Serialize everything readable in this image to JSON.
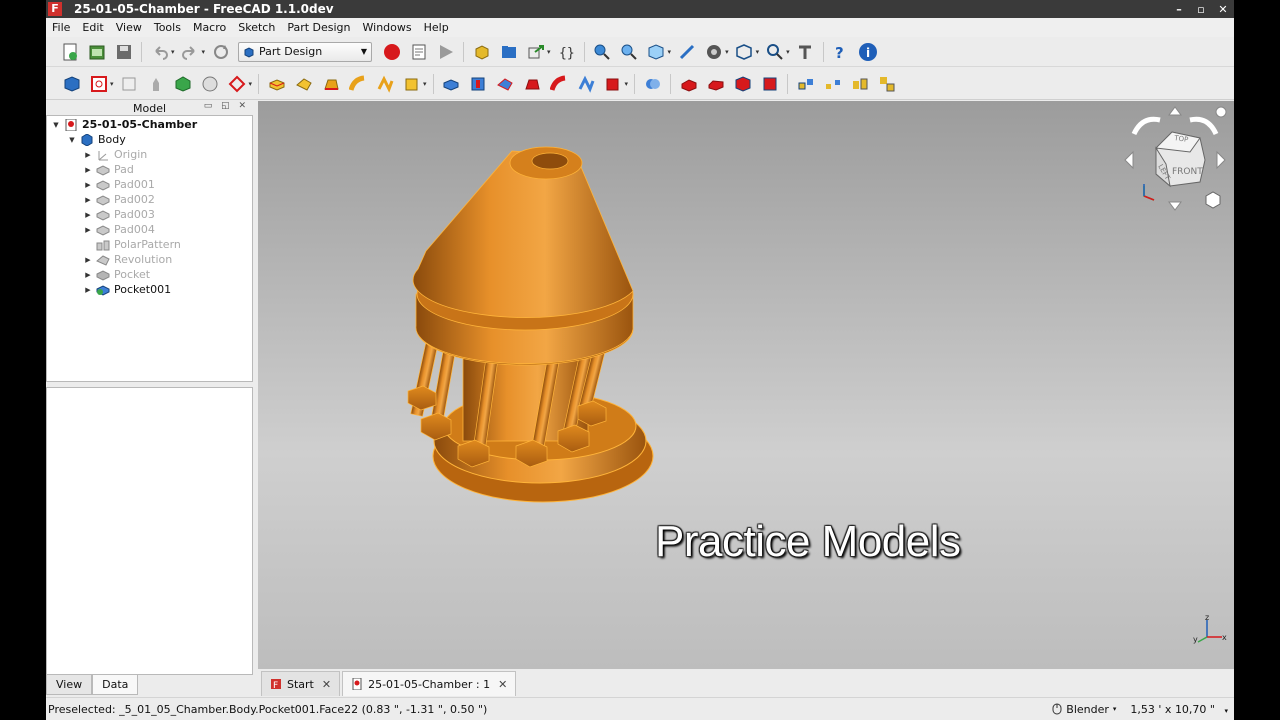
{
  "window": {
    "title": "25-01-05-Chamber - FreeCAD 1.1.0dev",
    "app_icon_letter": "F"
  },
  "menu": [
    "File",
    "Edit",
    "View",
    "Tools",
    "Macro",
    "Sketch",
    "Part Design",
    "Windows",
    "Help"
  ],
  "toolbar": {
    "workbench": "Part Design"
  },
  "model_panel": {
    "header": "Model",
    "root": "25-01-05-Chamber",
    "body": "Body",
    "features": [
      {
        "label": "Origin",
        "icon": "origin-icon"
      },
      {
        "label": "Pad",
        "icon": "pad-icon"
      },
      {
        "label": "Pad001",
        "icon": "pad-icon"
      },
      {
        "label": "Pad002",
        "icon": "pad-icon"
      },
      {
        "label": "Pad003",
        "icon": "pad-icon"
      },
      {
        "label": "Pad004",
        "icon": "pad-icon"
      },
      {
        "label": "PolarPattern",
        "icon": "polar-pattern-icon"
      },
      {
        "label": "Revolution",
        "icon": "revolution-icon"
      },
      {
        "label": "Pocket",
        "icon": "pocket-icon"
      },
      {
        "label": "Pocket001",
        "icon": "pocket-icon"
      }
    ]
  },
  "property_tabs": [
    "View",
    "Data"
  ],
  "viewport": {
    "overlay_text": "Practice Models",
    "navcube_labels": [
      "TOP",
      "LEFT",
      "FRONT"
    ],
    "axes": [
      "x",
      "y",
      "z"
    ]
  },
  "doc_tabs": [
    {
      "label": "Start",
      "close": "✕"
    },
    {
      "label": "25-01-05-Chamber : 1",
      "close": "✕"
    }
  ],
  "status": {
    "message": "Preselected: _5_01_05_Chamber.Body.Pocket001.Face22 (0.83 \", -1.31 \", 0.50 \")",
    "navigation_style": "Blender",
    "dimensions": "1,53 ' x 10,70 \""
  },
  "colors": {
    "accent": "#e08a1e",
    "record": "#d7191c",
    "info": "#1f5fb8"
  }
}
